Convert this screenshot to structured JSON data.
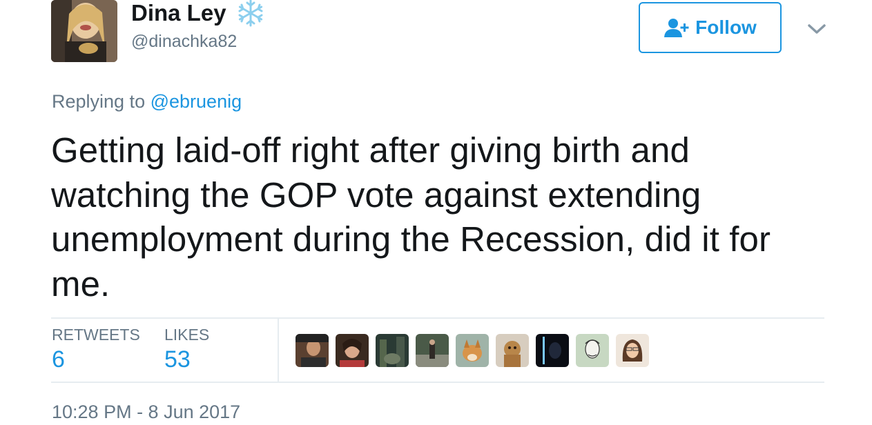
{
  "user": {
    "display_name": "Dina Ley",
    "handle": "@dinachka82",
    "name_emoji": "snowflake-icon"
  },
  "actions": {
    "follow_label": "Follow",
    "more_icon": "chevron-down-icon"
  },
  "reply": {
    "prefix": "Replying to",
    "mention": "@ebruenig"
  },
  "tweet": {
    "text": "Getting laid-off right after giving birth and watching the GOP vote against extending unemployment during the Recession, did it for me."
  },
  "stats": {
    "retweets_label": "RETWEETS",
    "retweets_value": "6",
    "likes_label": "LIKES",
    "likes_value": "53"
  },
  "likers": [
    {
      "avatar": "liker-avatar-1"
    },
    {
      "avatar": "liker-avatar-2"
    },
    {
      "avatar": "liker-avatar-3"
    },
    {
      "avatar": "liker-avatar-4"
    },
    {
      "avatar": "liker-avatar-5"
    },
    {
      "avatar": "liker-avatar-6"
    },
    {
      "avatar": "liker-avatar-7"
    },
    {
      "avatar": "liker-avatar-8"
    },
    {
      "avatar": "liker-avatar-9"
    }
  ],
  "timestamp": "10:28 PM - 8 Jun 2017",
  "colors": {
    "accent": "#1b95e0",
    "secondary_text": "#657786",
    "primary_text": "#14171a",
    "divider": "#e6ecf0"
  }
}
